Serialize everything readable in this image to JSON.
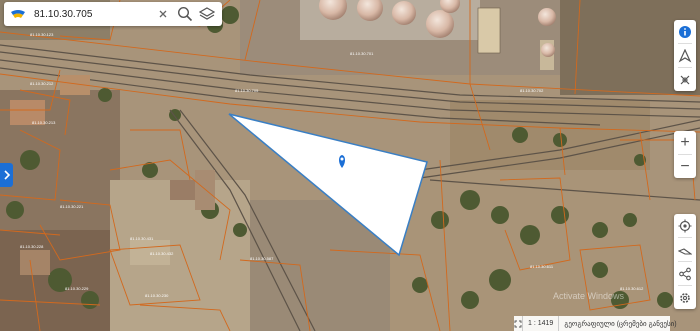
{
  "search": {
    "value": "81.10.30.705",
    "clear_icon": "close-icon",
    "search_icon": "search-icon",
    "layers_icon": "layers-icon"
  },
  "toolbar_top": {
    "icons": [
      "info-icon",
      "navigate-icon",
      "crosshair-icon"
    ]
  },
  "zoom": {
    "in_label": "+",
    "out_label": "−"
  },
  "toolbar_bottom": {
    "icons": [
      "my-location-icon",
      "measure-icon",
      "share-icon",
      "settings-icon"
    ]
  },
  "left_panel": {
    "icon": "chevron-right-icon"
  },
  "status": {
    "scale_label": "1 : 1419",
    "layer_label": "გეოგრაფიული (ცრემები განვესი)"
  },
  "watermark": {
    "text": "Activate Windows"
  },
  "colors": {
    "accent": "#1b6fd6",
    "parcel_fill": "#ffffff",
    "parcel_border": "#3a7fc4",
    "cadastral_lines": "#d2691e",
    "marker": "#1b6fd6"
  }
}
